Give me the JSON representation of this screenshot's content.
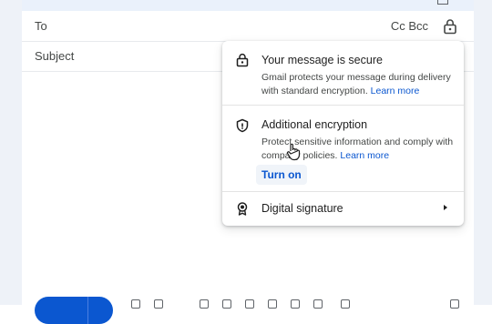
{
  "compose": {
    "to_label": "To",
    "cc_bcc": "Cc Bcc",
    "subject_label": "Subject"
  },
  "encryption_popup": {
    "secure": {
      "title": "Your message is secure",
      "description": "Gmail protects your message during delivery with standard encryption.",
      "link": "Learn more"
    },
    "additional": {
      "title": "Additional encryption",
      "description": "Protect sensitive information and comply with company policies.",
      "link": "Learn more",
      "button": "Turn on"
    },
    "signature": {
      "title": "Digital signature"
    }
  },
  "icons": {
    "lock": "lock-icon",
    "shield": "shield-icon",
    "certificate": "certificate-icon",
    "chevron": "chevron-right-icon",
    "cursor": "hand-pointer-icon"
  },
  "colors": {
    "accent": "#0b57d0",
    "text": "#1f1f1f",
    "secondary_text": "#444746",
    "divider": "#e3e3e3"
  }
}
